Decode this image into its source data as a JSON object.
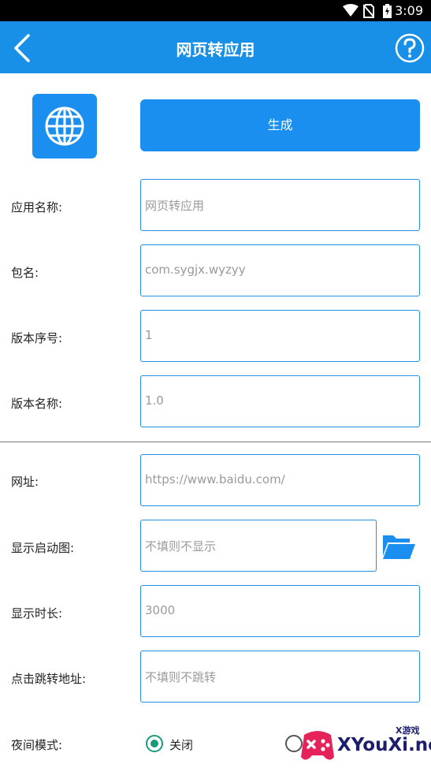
{
  "status_bar": {
    "time": "3:09",
    "icons": [
      "wifi-icon",
      "no-sim-icon",
      "battery-charging-icon"
    ]
  },
  "app_bar": {
    "title": "网页转应用",
    "back_icon": "chevron-left-icon",
    "help_icon": "help-circle-icon"
  },
  "header": {
    "app_icon": "globe-icon",
    "generate_label": "生成"
  },
  "form_top": [
    {
      "label": "应用名称:",
      "placeholder": "网页转应用"
    },
    {
      "label": "包名:",
      "placeholder": "com.sygjx.wyzyy"
    },
    {
      "label": "版本序号:",
      "placeholder": "1"
    },
    {
      "label": "版本名称:",
      "placeholder": "1.0"
    }
  ],
  "form_bottom": [
    {
      "label": "网址:",
      "placeholder": "https://www.baidu.com/"
    },
    {
      "label": "显示启动图:",
      "placeholder": "不填则不显示"
    },
    {
      "label": "显示时长:",
      "placeholder": "3000"
    },
    {
      "label": "点击跳转地址:",
      "placeholder": "不填则不跳转"
    }
  ],
  "night_mode": {
    "label": "夜间模式:",
    "options": [
      "关闭"
    ],
    "selected": "关闭"
  },
  "watermark": {
    "brand": "XYouXi.net",
    "tag": "X游戏"
  },
  "colors": {
    "primary": "#1890e8",
    "field_border": "#2490e0",
    "radio": "#1a9a7a"
  }
}
